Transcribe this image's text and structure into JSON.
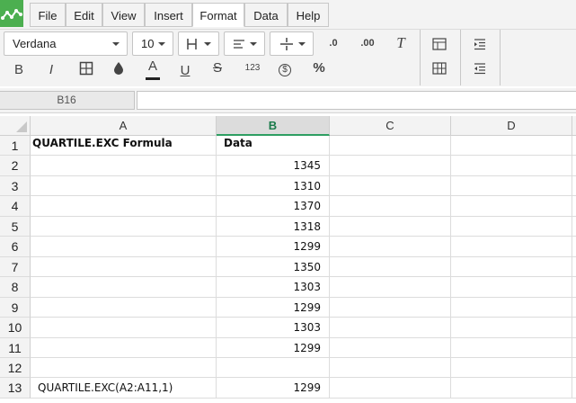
{
  "menu": {
    "items": [
      {
        "label": "File"
      },
      {
        "label": "Edit"
      },
      {
        "label": "View"
      },
      {
        "label": "Insert"
      },
      {
        "label": "Format",
        "active": true
      },
      {
        "label": "Data"
      },
      {
        "label": "Help"
      }
    ]
  },
  "toolbar": {
    "font_name": "Verdana",
    "font_size": "10",
    "decrease_decimals_label": ".0",
    "increase_decimals_label": ".00",
    "bold_label": "B",
    "italic_label": "I",
    "text_color_label": "A",
    "underline_label": "U",
    "strikethrough_label": "S",
    "number_format_label": "123",
    "currency_label": "$",
    "percent_label": "%"
  },
  "formula_bar": {
    "cell_ref": "B16",
    "formula": ""
  },
  "sheet": {
    "columns": [
      "A",
      "B",
      "C",
      "D"
    ],
    "selected_column": "B",
    "rows": [
      {
        "num": "1",
        "a": "QUARTILE.EXC Formula",
        "b": "Data"
      },
      {
        "num": "2",
        "a": "",
        "b": "1345"
      },
      {
        "num": "3",
        "a": "",
        "b": "1310"
      },
      {
        "num": "4",
        "a": "",
        "b": "1370"
      },
      {
        "num": "5",
        "a": "",
        "b": "1318"
      },
      {
        "num": "6",
        "a": "",
        "b": "1299"
      },
      {
        "num": "7",
        "a": "",
        "b": "1350"
      },
      {
        "num": "8",
        "a": "",
        "b": "1303"
      },
      {
        "num": "9",
        "a": "",
        "b": "1299"
      },
      {
        "num": "10",
        "a": "",
        "b": "1303"
      },
      {
        "num": "11",
        "a": "",
        "b": "1299"
      },
      {
        "num": "12",
        "a": "",
        "b": ""
      },
      {
        "num": "13",
        "a": "QUARTILE.EXC(A2:A11,1)",
        "b": "1299"
      }
    ]
  },
  "colors": {
    "accent_green": "#2e9e62",
    "logo_green": "#4caf50"
  }
}
